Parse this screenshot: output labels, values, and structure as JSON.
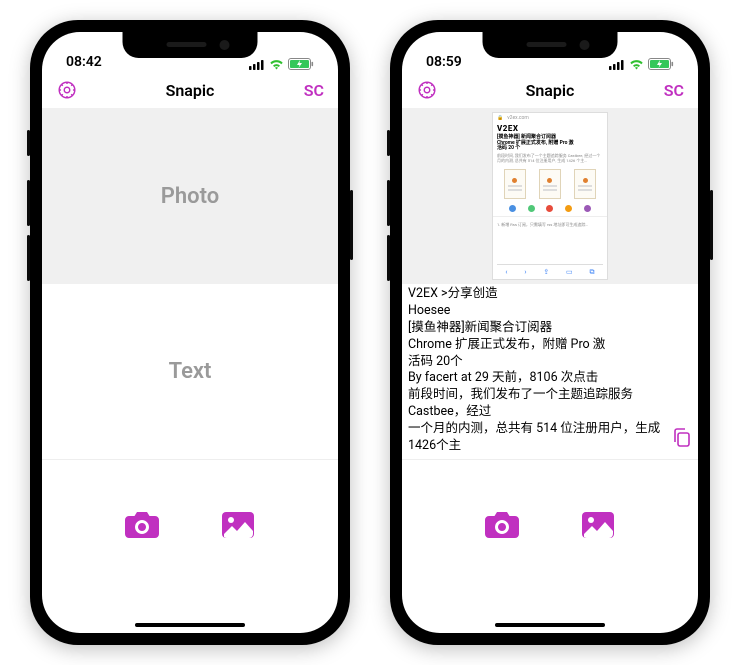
{
  "colors": {
    "accent": "#c030c0"
  },
  "phones": [
    {
      "status": {
        "time": "08:42"
      },
      "nav": {
        "title": "Snapic",
        "right": "SC"
      },
      "photo_placeholder": "Photo",
      "text_placeholder": "Text"
    },
    {
      "status": {
        "time": "08:59"
      },
      "nav": {
        "title": "Snapic",
        "right": "SC"
      },
      "thumbnail": {
        "url": "v2ex.com",
        "logo": "V2EX",
        "title": "[摸鱼神器] 新闻聚合订阅器\nChrome 扩展正式发布, 附赠 Pro 激\n活码 20 个"
      },
      "ocr_text": "V2EX >分享创造\nHoesee\n[摸鱼神器]新闻聚合订阅器\nChrome 扩展正式发布，附赠 Pro 激\n活码 20个\nBy facert at 29 天前，8106 次点击\n前段时间，我们发布了一个主题追踪服务\nCastbee，经过\n一个月的内测，总共有 514 位注册用户，生成\n1426个主"
    }
  ]
}
